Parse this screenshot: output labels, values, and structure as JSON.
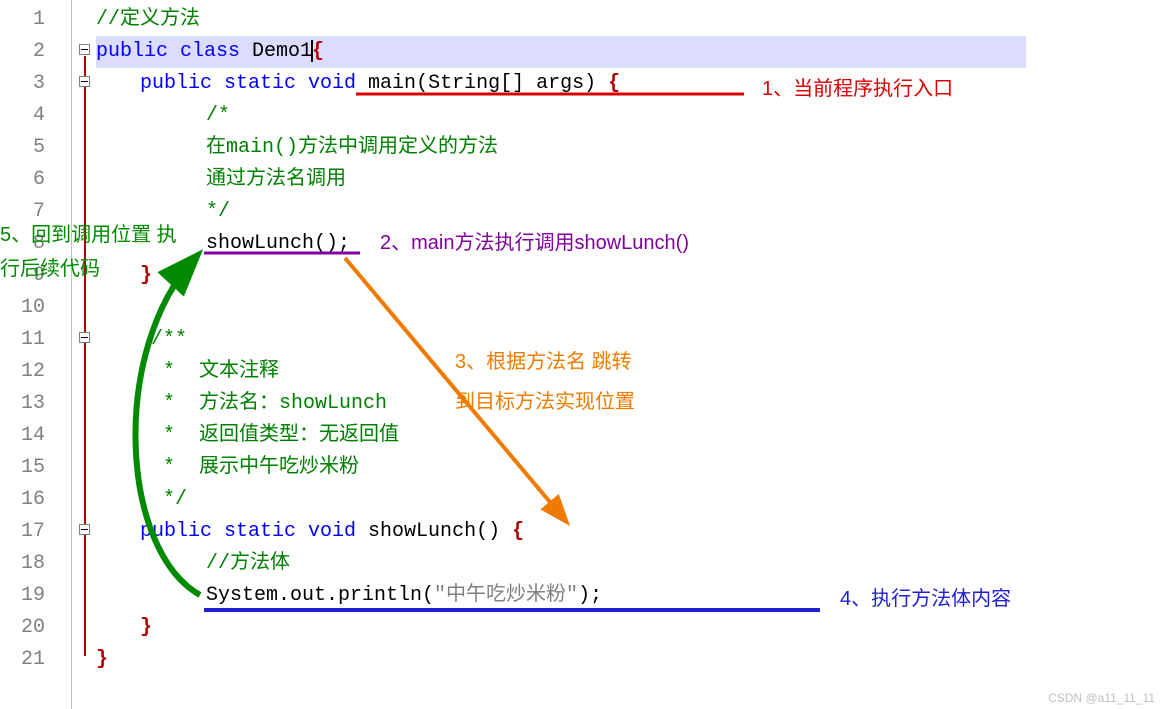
{
  "gutter": {
    "lines": [
      "1",
      "2",
      "3",
      "4",
      "5",
      "6",
      "7",
      "8",
      "9",
      "10",
      "11",
      "12",
      "13",
      "14",
      "15",
      "16",
      "17",
      "18",
      "19",
      "20",
      "21"
    ]
  },
  "code": {
    "l1_comment": "//定义方法",
    "l2_pub": "public",
    "l2_class": " class ",
    "l2_name": "Demo1",
    "l3_sig_pub": "public",
    "l3_sig_static": " static ",
    "l3_sig_void": "void",
    "l3_main": " main",
    "l3_args": "(String[] args) ",
    "l4_c": "/*",
    "l5_c": "在main()方法中调用定义的方法",
    "l6_c": "通过方法名调用",
    "l7_c": "*/",
    "l8_call": "showLunch",
    "l8_paren": "();",
    "l11_c": "/**",
    "l12_c": " *  文本注释",
    "l13_c": " *  方法名：showLunch",
    "l14_c": " *  返回值类型：无返回值",
    "l15_c": " *  展示中午吃炒米粉",
    "l16_c": " */",
    "l17_pub": "public",
    "l17_static": " static ",
    "l17_void": "void",
    "l17_name": " showLunch",
    "l17_paren": "() ",
    "l18_c": "//方法体",
    "l19_sys": "System.out.println(",
    "l19_str": "\"中午吃炒米粉\"",
    "l19_end": ");"
  },
  "annotations": {
    "a1": "1、当前程序执行入口",
    "a2": "2、main方法执行调用showLunch()",
    "a3_l1": "3、根据方法名 跳转",
    "a3_l2": "到目标方法实现位置",
    "a4": "4、执行方法体内容",
    "a5_l1": "5、回到调用位置 执",
    "a5_l2": "行后续代码"
  },
  "watermark": "CSDN @a11_11_11"
}
